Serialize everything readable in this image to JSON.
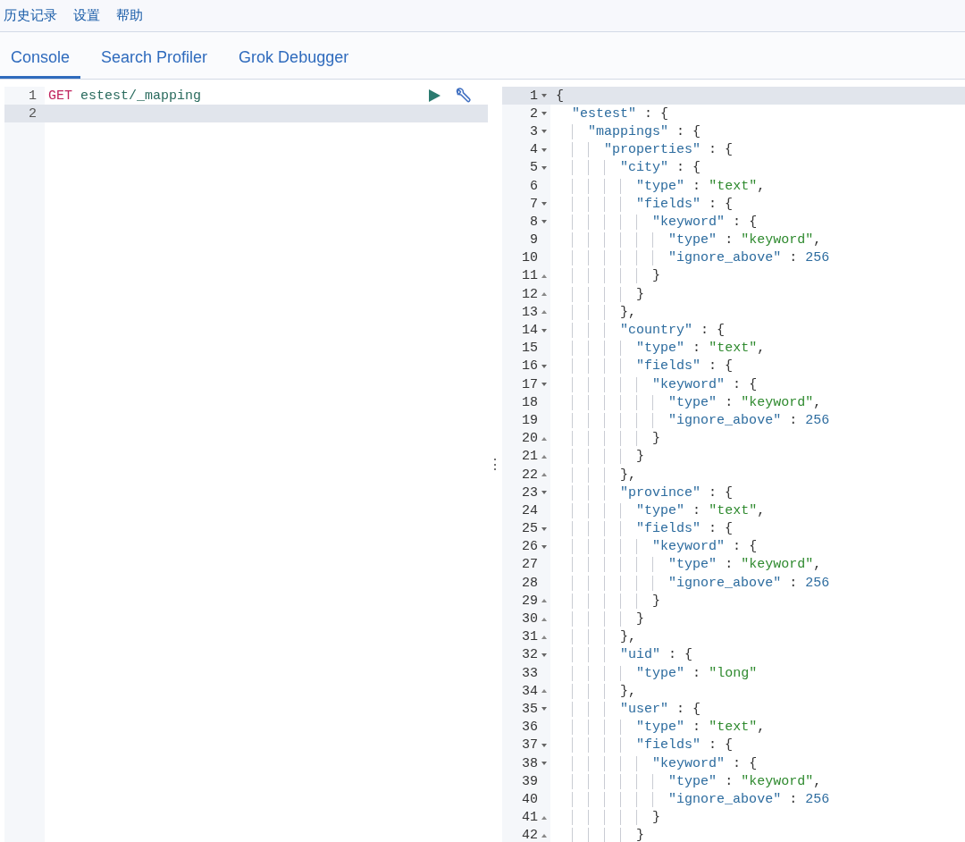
{
  "top_menu": [
    {
      "label": "历史记录"
    },
    {
      "label": "设置"
    },
    {
      "label": "帮助"
    }
  ],
  "tabs": [
    {
      "label": "Console",
      "selected": true
    },
    {
      "label": "Search Profiler",
      "selected": false
    },
    {
      "label": "Grok Debugger",
      "selected": false
    }
  ],
  "request_editor": {
    "lines": [
      {
        "number": "1",
        "method": "GET",
        "path": "estest/_mapping",
        "active": false
      },
      {
        "number": "2",
        "active": true
      }
    ]
  },
  "divider": {
    "handle": "⋮"
  },
  "response_editor": {
    "lines": [
      {
        "number": "1",
        "text": "{",
        "kind": "foldstart",
        "active": true
      },
      {
        "number": "2",
        "text": "  \"estest\" : {",
        "kind": "foldstart",
        "active": false
      },
      {
        "number": "3",
        "text": "    \"mappings\" : {",
        "kind": "foldstart",
        "active": false
      },
      {
        "number": "4",
        "text": "      \"properties\" : {",
        "kind": "foldstart",
        "active": false
      },
      {
        "number": "5",
        "text": "        \"city\" : {",
        "kind": "foldstart",
        "active": false
      },
      {
        "number": "6",
        "text": "          \"type\" : \"text\",",
        "kind": "plain",
        "active": false
      },
      {
        "number": "7",
        "text": "          \"fields\" : {",
        "kind": "foldstart",
        "active": false
      },
      {
        "number": "8",
        "text": "            \"keyword\" : {",
        "kind": "foldstart",
        "active": false
      },
      {
        "number": "9",
        "text": "              \"type\" : \"keyword\",",
        "kind": "plain",
        "active": false
      },
      {
        "number": "10",
        "text": "              \"ignore_above\" : 256",
        "kind": "plain",
        "active": false
      },
      {
        "number": "11",
        "text": "            }",
        "kind": "foldend",
        "active": false
      },
      {
        "number": "12",
        "text": "          }",
        "kind": "foldend",
        "active": false
      },
      {
        "number": "13",
        "text": "        },",
        "kind": "foldend",
        "active": false
      },
      {
        "number": "14",
        "text": "        \"country\" : {",
        "kind": "foldstart",
        "active": false
      },
      {
        "number": "15",
        "text": "          \"type\" : \"text\",",
        "kind": "plain",
        "active": false
      },
      {
        "number": "16",
        "text": "          \"fields\" : {",
        "kind": "foldstart",
        "active": false
      },
      {
        "number": "17",
        "text": "            \"keyword\" : {",
        "kind": "foldstart",
        "active": false
      },
      {
        "number": "18",
        "text": "              \"type\" : \"keyword\",",
        "kind": "plain",
        "active": false
      },
      {
        "number": "19",
        "text": "              \"ignore_above\" : 256",
        "kind": "plain",
        "active": false
      },
      {
        "number": "20",
        "text": "            }",
        "kind": "foldend",
        "active": false
      },
      {
        "number": "21",
        "text": "          }",
        "kind": "foldend",
        "active": false
      },
      {
        "number": "22",
        "text": "        },",
        "kind": "foldend",
        "active": false
      },
      {
        "number": "23",
        "text": "        \"province\" : {",
        "kind": "foldstart",
        "active": false
      },
      {
        "number": "24",
        "text": "          \"type\" : \"text\",",
        "kind": "plain",
        "active": false
      },
      {
        "number": "25",
        "text": "          \"fields\" : {",
        "kind": "foldstart",
        "active": false
      },
      {
        "number": "26",
        "text": "            \"keyword\" : {",
        "kind": "foldstart",
        "active": false
      },
      {
        "number": "27",
        "text": "              \"type\" : \"keyword\",",
        "kind": "plain",
        "active": false
      },
      {
        "number": "28",
        "text": "              \"ignore_above\" : 256",
        "kind": "plain",
        "active": false
      },
      {
        "number": "29",
        "text": "            }",
        "kind": "foldend",
        "active": false
      },
      {
        "number": "30",
        "text": "          }",
        "kind": "foldend",
        "active": false
      },
      {
        "number": "31",
        "text": "        },",
        "kind": "foldend",
        "active": false
      },
      {
        "number": "32",
        "text": "        \"uid\" : {",
        "kind": "foldstart",
        "active": false
      },
      {
        "number": "33",
        "text": "          \"type\" : \"long\"",
        "kind": "plain",
        "active": false
      },
      {
        "number": "34",
        "text": "        },",
        "kind": "foldend",
        "active": false
      },
      {
        "number": "35",
        "text": "        \"user\" : {",
        "kind": "foldstart",
        "active": false
      },
      {
        "number": "36",
        "text": "          \"type\" : \"text\",",
        "kind": "plain",
        "active": false
      },
      {
        "number": "37",
        "text": "          \"fields\" : {",
        "kind": "foldstart",
        "active": false
      },
      {
        "number": "38",
        "text": "            \"keyword\" : {",
        "kind": "foldstart",
        "active": false
      },
      {
        "number": "39",
        "text": "              \"type\" : \"keyword\",",
        "kind": "plain",
        "active": false
      },
      {
        "number": "40",
        "text": "              \"ignore_above\" : 256",
        "kind": "plain",
        "active": false
      },
      {
        "number": "41",
        "text": "            }",
        "kind": "foldend",
        "active": false
      },
      {
        "number": "42",
        "text": "          }",
        "kind": "foldend",
        "active": false
      }
    ]
  }
}
